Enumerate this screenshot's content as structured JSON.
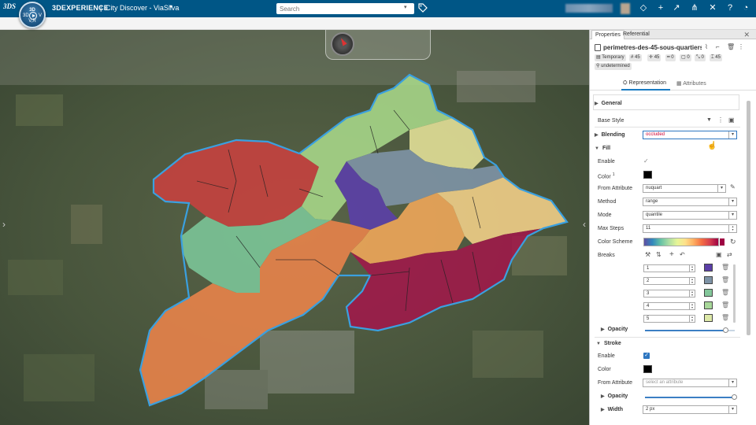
{
  "topbar": {
    "brand": "3DEXPERIENCE",
    "separator": "|",
    "app_title": "City Discover - ViaSilva",
    "search_placeholder": "Search",
    "compass": {
      "top": "3D",
      "left": "3D",
      "right": "V",
      "bottom": "V,R"
    },
    "logo": "3DS"
  },
  "panel": {
    "tabs": [
      "Properties",
      "Referential"
    ],
    "layer_name": "perimetres-des-45-sous-quartiers-...",
    "tags": [
      "Temporary",
      "45",
      "45",
      "0",
      "0",
      "0",
      "45",
      "undetermined"
    ],
    "subtabs": {
      "representation": "Representation",
      "attributes": "Attributes"
    },
    "general": "General",
    "base_style": "Base Style",
    "blending": {
      "label": "Blending",
      "value": "occluded"
    },
    "fill": {
      "label": "Fill",
      "enable": "Enable",
      "color": "Color",
      "color_marker": "1",
      "from_attribute": {
        "label": "From Attribute",
        "value": "nuquart"
      },
      "method": {
        "label": "Method",
        "value": "range"
      },
      "mode": {
        "label": "Mode",
        "value": "quantile"
      },
      "max_steps": {
        "label": "Max Steps",
        "value": "11"
      },
      "color_scheme": "Color Scheme",
      "breaks": "Breaks",
      "break_rows": [
        {
          "value": "1",
          "color": "#5b3fa8"
        },
        {
          "value": "2",
          "color": "#7e93a6"
        },
        {
          "value": "3",
          "color": "#83c79a"
        },
        {
          "value": "4",
          "color": "#a8d89a"
        },
        {
          "value": "5",
          "color": "#dde9a8"
        }
      ],
      "opacity": "Opacity",
      "opacity_value": 0.9
    },
    "stroke": {
      "label": "Stroke",
      "enable": "Enable",
      "color": "Color",
      "from_attribute": {
        "label": "From Attribute",
        "placeholder": "select an attribute"
      },
      "opacity": "Opacity",
      "opacity_value": 1.0,
      "width": {
        "label": "Width",
        "value": "2 px"
      }
    }
  },
  "colors": {
    "topbar": "#005686",
    "accent": "#1a7bc2",
    "regions": [
      "#c8413f",
      "#e8834a",
      "#f2a85a",
      "#f5d28a",
      "#e6e39a",
      "#a8d88a",
      "#7cc79a",
      "#7e93a6",
      "#5b3fa8",
      "#a0184a"
    ]
  }
}
